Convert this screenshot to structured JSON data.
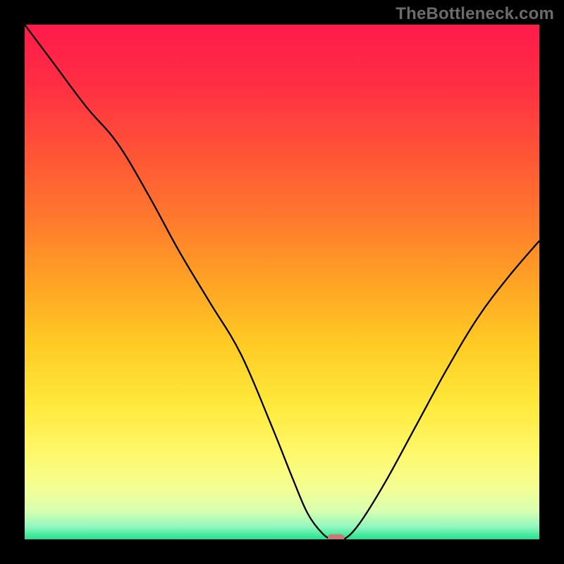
{
  "watermark": "TheBottleneck.com",
  "chart_data": {
    "type": "line",
    "title": "",
    "xlabel": "",
    "ylabel": "",
    "xlim": [
      0,
      100
    ],
    "ylim": [
      0,
      100
    ],
    "x": [
      0,
      6,
      12,
      18,
      24,
      30,
      36,
      42,
      48,
      52,
      55,
      58,
      60,
      62,
      65,
      70,
      76,
      82,
      88,
      94,
      100
    ],
    "values": [
      100,
      92,
      84,
      77,
      67,
      56,
      46,
      36,
      22,
      12,
      5,
      1,
      0,
      0,
      3,
      11,
      22,
      33,
      43,
      51,
      58
    ],
    "plateau": {
      "x_start": 58,
      "x_end": 62,
      "y": 0
    },
    "marker": {
      "x": 60.5,
      "y": 0,
      "width": 3.2,
      "height": 2.0,
      "color": "#c97a76"
    },
    "gradient_stops": [
      {
        "offset": 0.0,
        "color": "#ff1a4b"
      },
      {
        "offset": 0.12,
        "color": "#ff2f43"
      },
      {
        "offset": 0.25,
        "color": "#ff5436"
      },
      {
        "offset": 0.38,
        "color": "#ff7a2c"
      },
      {
        "offset": 0.5,
        "color": "#ffa325"
      },
      {
        "offset": 0.62,
        "color": "#ffcb23"
      },
      {
        "offset": 0.74,
        "color": "#ffe93c"
      },
      {
        "offset": 0.83,
        "color": "#fff86a"
      },
      {
        "offset": 0.9,
        "color": "#f4ff93"
      },
      {
        "offset": 0.945,
        "color": "#d8ffb0"
      },
      {
        "offset": 0.975,
        "color": "#93f7bf"
      },
      {
        "offset": 1.0,
        "color": "#1fe28f"
      }
    ]
  }
}
